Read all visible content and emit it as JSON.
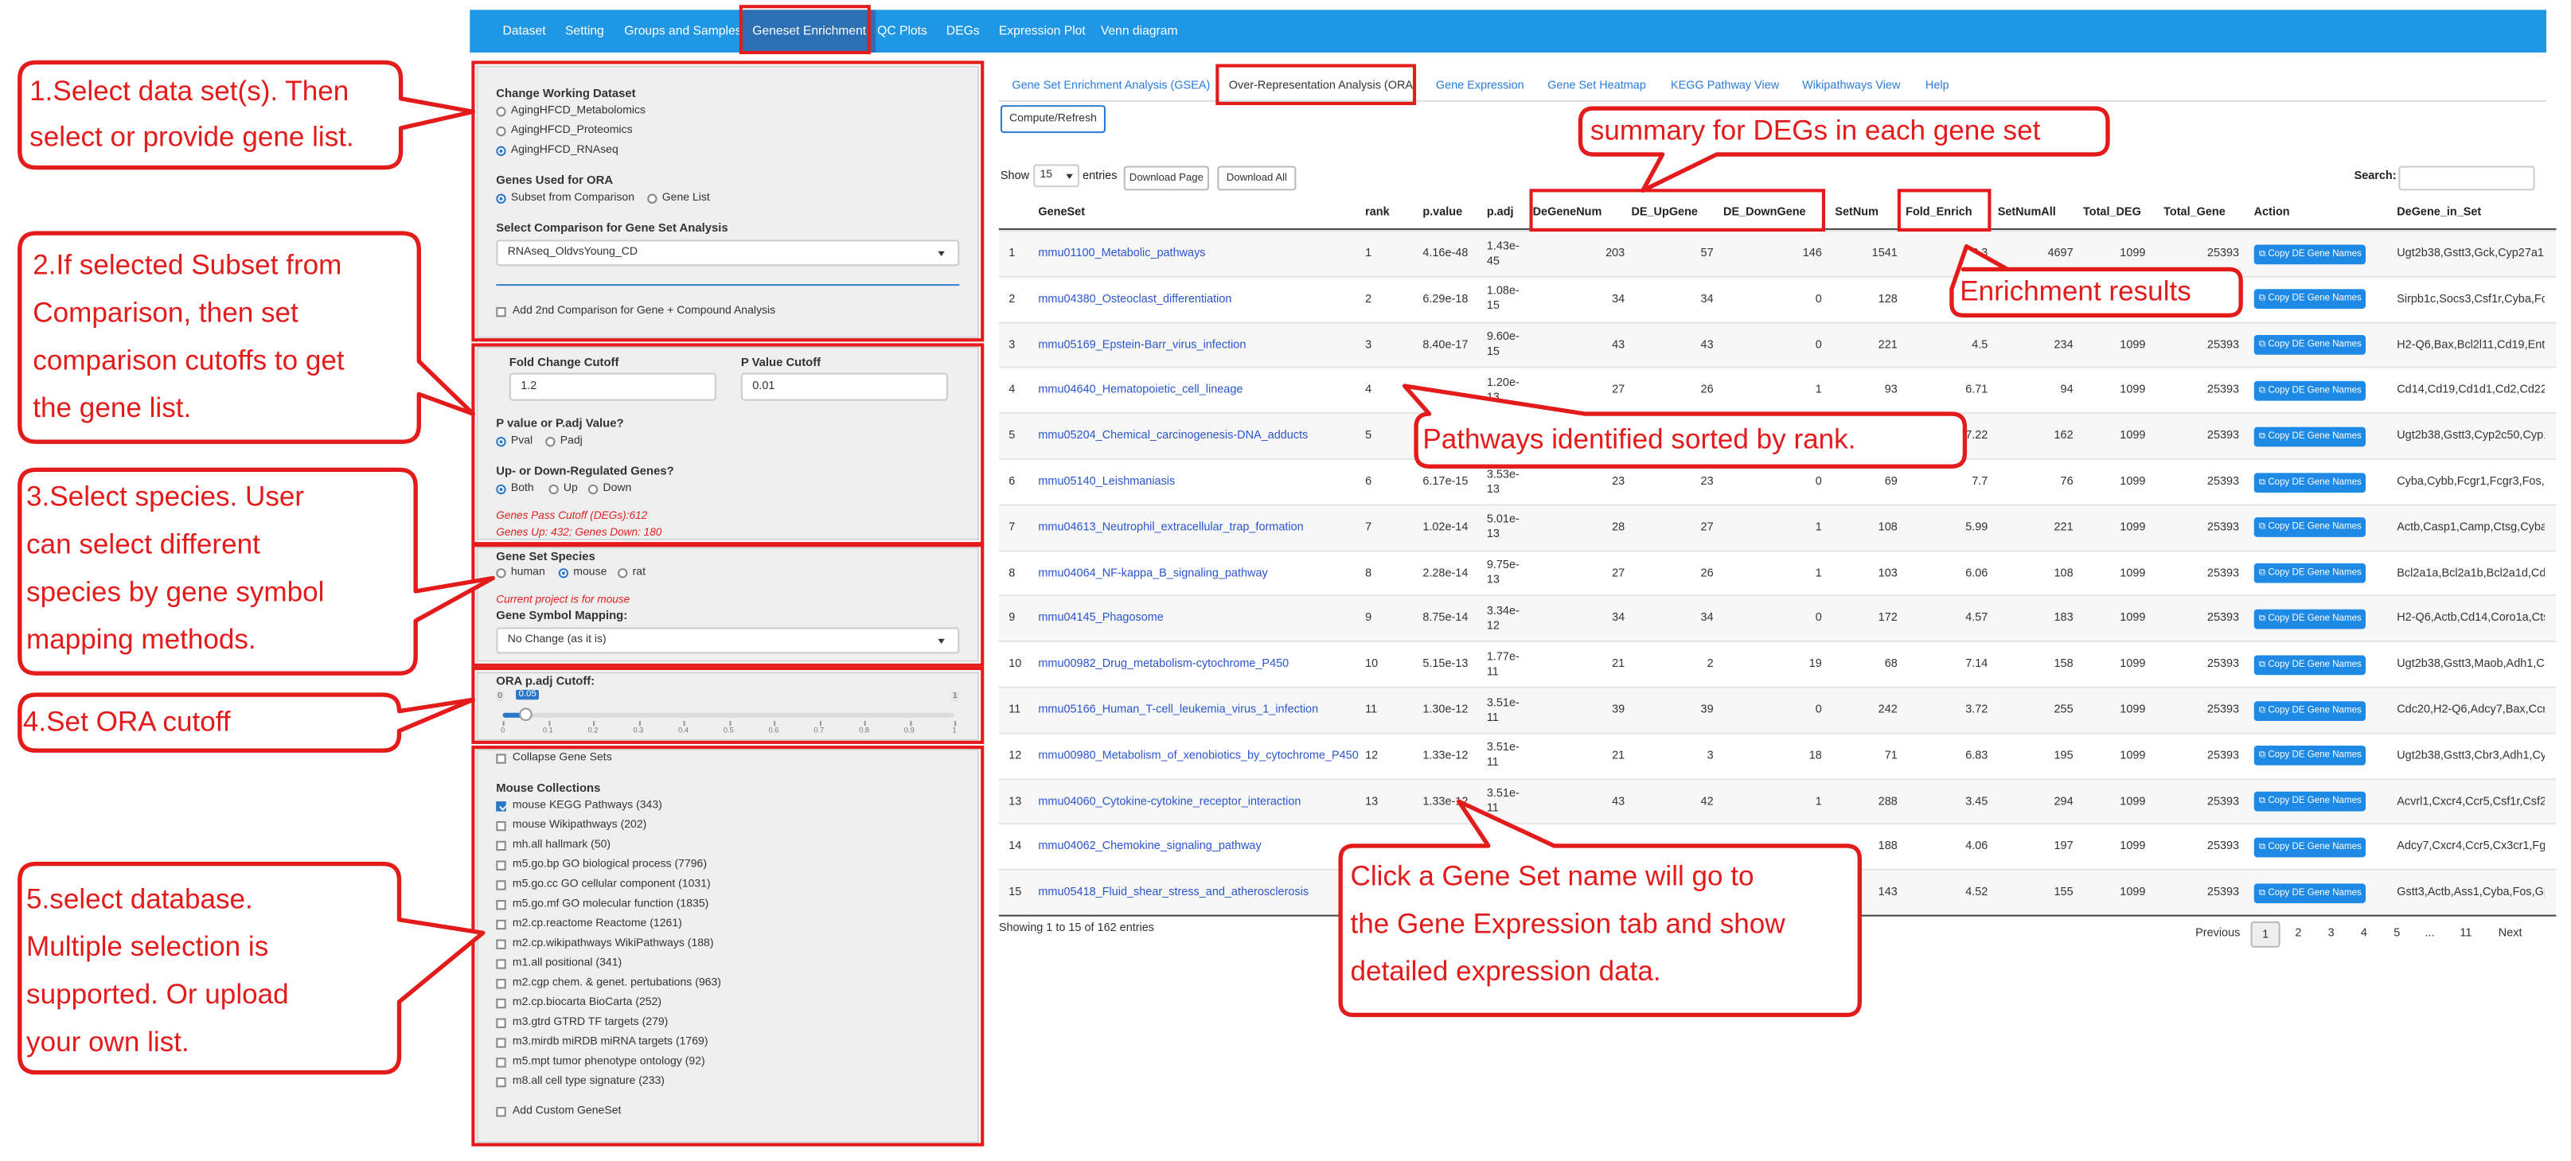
{
  "nav": [
    "Dataset",
    "Setting",
    "Groups and Samples",
    "Geneset Enrichment",
    "QC Plots",
    "DEGs",
    "Expression Plot",
    "Venn diagram"
  ],
  "dataset": {
    "title": "Change Working Dataset",
    "options": [
      "AgingHFCD_Metabolomics",
      "AgingHFCD_Proteomics",
      "AgingHFCD_RNAseq"
    ],
    "selected_index": 2
  },
  "genes_ora": {
    "title": "Genes Used for ORA",
    "options": [
      "Subset from Comparison",
      "Gene List"
    ],
    "selected_index": 0
  },
  "comparison": {
    "title": "Select Comparison for Gene Set Analysis",
    "value": "RNAseq_OldvsYoung_CD",
    "second_label": "Add 2nd Comparison for Gene + Compound Analysis"
  },
  "cutoffs": {
    "fc_label": "Fold Change Cutoff",
    "fc_value": "1.2",
    "p_label": "P Value Cutoff",
    "p_value": "0.01",
    "pv_title": "P value or P.adj Value?",
    "pv_options": [
      "Pval",
      "Padj"
    ],
    "pv_selected": 0,
    "updown_title": "Up- or Down-Regulated Genes?",
    "updown_options": [
      "Both",
      "Up",
      "Down"
    ],
    "updown_selected": 0,
    "pass_line1": "Genes Pass Cutoff (DEGs):612",
    "pass_line2": "Genes Up: 432; Genes Down: 180"
  },
  "species": {
    "title": "Gene Set Species",
    "options": [
      "human",
      "mouse",
      "rat"
    ],
    "selected_index": 1,
    "note": "Current project is for mouse",
    "mapping_title": "Gene Symbol Mapping:",
    "mapping_value": "No Change (as it is)"
  },
  "ora_cutoff": {
    "title": "ORA p.adj Cutoff:",
    "min": "0",
    "max": "1",
    "value": 0.05,
    "value_label": "0.05",
    "ticks": [
      "0",
      "0.1",
      "0.2",
      "0.3",
      "0.4",
      "0.5",
      "0.6",
      "0.7",
      "0.8",
      "0.9",
      "1"
    ]
  },
  "collections": {
    "collapse_label": "Collapse Gene Sets",
    "title": "Mouse Collections",
    "items": [
      {
        "label": "mouse KEGG Pathways (343)",
        "checked": true
      },
      {
        "label": "mouse Wikipathways (202)",
        "checked": false
      },
      {
        "label": "mh.all hallmark (50)",
        "checked": false
      },
      {
        "label": "m5.go.bp GO biological process (7796)",
        "checked": false
      },
      {
        "label": "m5.go.cc GO cellular component (1031)",
        "checked": false
      },
      {
        "label": "m5.go.mf GO molecular function (1835)",
        "checked": false
      },
      {
        "label": "m2.cp.reactome Reactome (1261)",
        "checked": false
      },
      {
        "label": "m2.cp.wikipathways WikiPathways (188)",
        "checked": false
      },
      {
        "label": "m1.all positional (341)",
        "checked": false
      },
      {
        "label": "m2.cgp chem. & genet. pertubations (963)",
        "checked": false
      },
      {
        "label": "m2.cp.biocarta BioCarta (252)",
        "checked": false
      },
      {
        "label": "m3.gtrd GTRD TF targets (279)",
        "checked": false
      },
      {
        "label": "m3.mirdb miRDB miRNA targets (1769)",
        "checked": false
      },
      {
        "label": "m5.mpt tumor phenotype ontology (92)",
        "checked": false
      },
      {
        "label": "m8.all cell type signature (233)",
        "checked": false
      }
    ],
    "custom_label": "Add Custom GeneSet"
  },
  "tabs": [
    "Gene Set Enrichment Analysis (GSEA)",
    "Over-Representation Analysis (ORA)",
    "Gene Expression",
    "Gene Set Heatmap",
    "KEGG Pathway View",
    "Wikipathways View",
    "Help"
  ],
  "compute_label": "Compute/Refresh",
  "table_controls": {
    "show_label": "Show",
    "show_value": "15",
    "entries_label": "entries",
    "download_page": "Download Page",
    "download_all": "Download All",
    "search_label": "Search:"
  },
  "columns": [
    "GeneSet",
    "rank",
    "p.value",
    "p.adj",
    "DeGeneNum",
    "DE_UpGene",
    "DE_DownGene",
    "SetNum",
    "Fold_Enrich",
    "SetNumAll",
    "Total_DEG",
    "Total_Gene",
    "Action",
    "DeGene_in_Set"
  ],
  "copy_label": "Copy DE Gene Names",
  "rows": [
    {
      "n": "1",
      "gs": "mmu01100_Metabolic_pathways",
      "rank": "1",
      "pv": "4.16e-48",
      "pa1": "1.43e-",
      "pa2": "45",
      "dg": "203",
      "up": "57",
      "dn": "146",
      "sn": "1541",
      "fe": "3.3",
      "sna": "4697",
      "td": "1099",
      "tg": "25393",
      "genes": "Ugt2b38,Gstt3,Gck,Cyp27a1,Ac"
    },
    {
      "n": "2",
      "gs": "mmu04380_Osteoclast_differentiation",
      "rank": "2",
      "pv": "6.29e-18",
      "pa1": "1.08e-",
      "pa2": "15",
      "dg": "34",
      "up": "34",
      "dn": "0",
      "sn": "128",
      "fe": "",
      "sna": "",
      "td": "1099",
      "tg": "25393",
      "genes": "Sirpb1c,Socs3,Csf1r,Cyba,Fcgr"
    },
    {
      "n": "3",
      "gs": "mmu05169_Epstein-Barr_virus_infection",
      "rank": "3",
      "pv": "8.40e-17",
      "pa1": "9.60e-",
      "pa2": "15",
      "dg": "43",
      "up": "43",
      "dn": "0",
      "sn": "221",
      "fe": "4.5",
      "sna": "234",
      "td": "1099",
      "tg": "25393",
      "genes": "H2-Q6,Bax,Bcl2l11,Cd19,Entpc"
    },
    {
      "n": "4",
      "gs": "mmu04640_Hematopoietic_cell_lineage",
      "rank": "4",
      "pv": "",
      "pa1": "1.20e-",
      "pa2": "13",
      "dg": "27",
      "up": "26",
      "dn": "1",
      "sn": "93",
      "fe": "6.71",
      "sna": "94",
      "td": "1099",
      "tg": "25393",
      "genes": "Cd14,Cd19,Cd1d1,Cd2,Cd22,C"
    },
    {
      "n": "5",
      "gs": "mmu05204_Chemical_carcinogenesis-DNA_adducts",
      "rank": "5",
      "pv": "",
      "pa1": "",
      "pa2": "",
      "dg": "",
      "up": "",
      "dn": "",
      "sn": "",
      "fe": "7.22",
      "sna": "162",
      "td": "1099",
      "tg": "25393",
      "genes": "Ugt2b38,Gstt3,Cyp2c50,Cyp1a"
    },
    {
      "n": "6",
      "gs": "mmu05140_Leishmaniasis",
      "rank": "6",
      "pv": "6.17e-15",
      "pa1": "3.53e-",
      "pa2": "13",
      "dg": "23",
      "up": "23",
      "dn": "0",
      "sn": "69",
      "fe": "7.7",
      "sna": "76",
      "td": "1099",
      "tg": "25393",
      "genes": "Cyba,Cybb,Fcgr1,Fcgr3,Fos,H2"
    },
    {
      "n": "7",
      "gs": "mmu04613_Neutrophil_extracellular_trap_formation",
      "rank": "7",
      "pv": "1.02e-14",
      "pa1": "5.01e-",
      "pa2": "13",
      "dg": "28",
      "up": "27",
      "dn": "1",
      "sn": "108",
      "fe": "5.99",
      "sna": "221",
      "td": "1099",
      "tg": "25393",
      "genes": "Actb,Casp1,Camp,Ctsg,Cyba,C"
    },
    {
      "n": "8",
      "gs": "mmu04064_NF-kappa_B_signaling_pathway",
      "rank": "8",
      "pv": "2.28e-14",
      "pa1": "9.75e-",
      "pa2": "13",
      "dg": "27",
      "up": "26",
      "dn": "1",
      "sn": "103",
      "fe": "6.06",
      "sna": "108",
      "td": "1099",
      "tg": "25393",
      "genes": "Bcl2a1a,Bcl2a1b,Bcl2a1d,Cd14"
    },
    {
      "n": "9",
      "gs": "mmu04145_Phagosome",
      "rank": "9",
      "pv": "8.75e-14",
      "pa1": "3.34e-",
      "pa2": "12",
      "dg": "34",
      "up": "34",
      "dn": "0",
      "sn": "172",
      "fe": "4.57",
      "sna": "183",
      "td": "1099",
      "tg": "25393",
      "genes": "H2-Q6,Actb,Cd14,Coro1a,Ctss,"
    },
    {
      "n": "10",
      "gs": "mmu00982_Drug_metabolism-cytochrome_P450",
      "rank": "10",
      "pv": "5.15e-13",
      "pa1": "1.77e-",
      "pa2": "11",
      "dg": "21",
      "up": "2",
      "dn": "19",
      "sn": "68",
      "fe": "7.14",
      "sna": "158",
      "td": "1099",
      "tg": "25393",
      "genes": "Ugt2b38,Gstt3,Maob,Adh1,Cyp"
    },
    {
      "n": "11",
      "gs": "mmu05166_Human_T-cell_leukemia_virus_1_infection",
      "rank": "11",
      "pv": "1.30e-12",
      "pa1": "3.51e-",
      "pa2": "11",
      "dg": "39",
      "up": "39",
      "dn": "0",
      "sn": "242",
      "fe": "3.72",
      "sna": "255",
      "td": "1099",
      "tg": "25393",
      "genes": "Cdc20,H2-Q6,Adcy7,Bax,Ccnb"
    },
    {
      "n": "12",
      "gs": "mmu00980_Metabolism_of_xenobiotics_by_cytochrome_P450",
      "rank": "12",
      "pv": "1.33e-12",
      "pa1": "3.51e-",
      "pa2": "11",
      "dg": "21",
      "up": "3",
      "dn": "18",
      "sn": "71",
      "fe": "6.83",
      "sna": "195",
      "td": "1099",
      "tg": "25393",
      "genes": "Ugt2b38,Gstt3,Cbr3,Adh1,Cyp"
    },
    {
      "n": "13",
      "gs": "mmu04060_Cytokine-cytokine_receptor_interaction",
      "rank": "13",
      "pv": "1.33e-12",
      "pa1": "3.51e-",
      "pa2": "11",
      "dg": "43",
      "up": "42",
      "dn": "1",
      "sn": "288",
      "fe": "3.45",
      "sna": "294",
      "td": "1099",
      "tg": "25393",
      "genes": "Acvrl1,Cxcr4,Ccr5,Csf1r,Csf2ra"
    },
    {
      "n": "14",
      "gs": "mmu04062_Chemokine_signaling_pathway",
      "rank": "",
      "pv": "",
      "pa1": "",
      "pa2": "",
      "dg": "",
      "up": "",
      "dn": "",
      "sn": "188",
      "fe": "4.06",
      "sna": "197",
      "td": "1099",
      "tg": "25393",
      "genes": "Adcy7,Cxcr4,Ccr5,Cx3cr1,Fgr,C"
    },
    {
      "n": "15",
      "gs": "mmu05418_Fluid_shear_stress_and_atherosclerosis",
      "rank": "",
      "pv": "",
      "pa1": "",
      "pa2": "",
      "dg": "",
      "up": "",
      "dn": "",
      "sn": "143",
      "fe": "4.52",
      "sna": "155",
      "td": "1099",
      "tg": "25393",
      "genes": "Gstt3,Actb,Ass1,Cyba,Fos,Gpc"
    }
  ],
  "table_footer": {
    "info": "Showing 1 to 15 of 162 entries",
    "previous": "Previous",
    "pages": [
      "1",
      "2",
      "3",
      "4",
      "5",
      "...",
      "11"
    ],
    "next": "Next"
  },
  "annotations": {
    "a1": [
      "1.Select data set(s).  Then",
      "select or provide gene list."
    ],
    "a2": [
      "2.If selected Subset from",
      "Comparison, then set",
      "comparison cutoffs to get",
      "the gene list."
    ],
    "a3": [
      "3.Select species. User",
      "can select different",
      "species by gene symbol",
      "mapping methods."
    ],
    "a4": [
      "4.Set ORA cutoff"
    ],
    "a5": [
      "5.select database.",
      "Multiple selection is",
      "supported. Or upload",
      "your own list."
    ],
    "summary": "summary for DEGs in each gene set",
    "enrichment": "Enrichment results",
    "pathways": "Pathways identified sorted by rank.",
    "click": [
      "Click a Gene Set name will go to",
      "the Gene Expression tab and show",
      "detailed expression data."
    ]
  },
  "colors": {
    "navbar": "#1f97e4",
    "accent": "#e41b1b",
    "link": "#2a55d0",
    "button": "#1f8ae6"
  }
}
